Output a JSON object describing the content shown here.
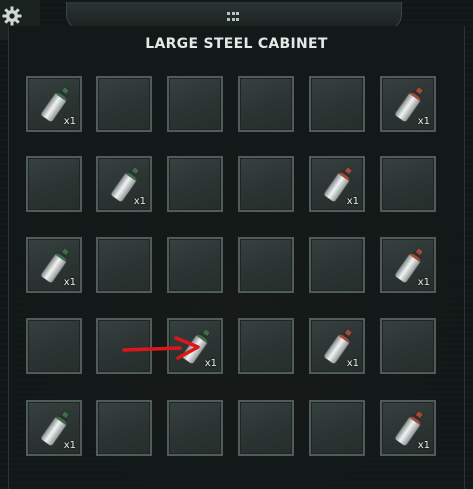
{
  "window": {
    "title": "LARGE STEEL CABINET"
  },
  "colors": {
    "green_cap": "#3f6b48",
    "red_cap": "#a54a36",
    "annotation_arrow": "#e0141b"
  },
  "slots": [
    {
      "item": "green-canister",
      "qty": "x1"
    },
    {
      "item": null
    },
    {
      "item": null
    },
    {
      "item": null
    },
    {
      "item": null
    },
    {
      "item": "red-canister",
      "qty": "x1"
    },
    {
      "item": null
    },
    {
      "item": "green-canister",
      "qty": "x1"
    },
    {
      "item": null
    },
    {
      "item": null
    },
    {
      "item": "red-canister",
      "qty": "x1"
    },
    {
      "item": null
    },
    {
      "item": "green-canister",
      "qty": "x1"
    },
    {
      "item": null
    },
    {
      "item": null
    },
    {
      "item": null
    },
    {
      "item": null
    },
    {
      "item": "red-canister",
      "qty": "x1"
    },
    {
      "item": null
    },
    {
      "item": null
    },
    {
      "item": "green-canister",
      "qty": "x1"
    },
    {
      "item": null
    },
    {
      "item": "red-canister",
      "qty": "x1"
    },
    {
      "item": null
    },
    {
      "item": "green-canister",
      "qty": "x1"
    },
    {
      "item": null
    },
    {
      "item": null
    },
    {
      "item": null
    },
    {
      "item": null
    },
    {
      "item": "red-canister",
      "qty": "x1"
    }
  ]
}
